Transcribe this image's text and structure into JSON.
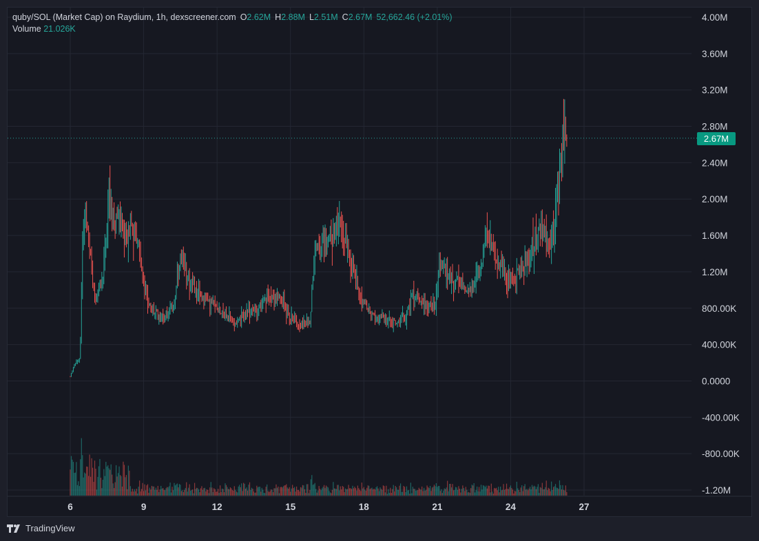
{
  "legend": {
    "symbol": "quby/SOL (Market Cap) on Raydium, 1h, dexscreener.com",
    "o_label": "O",
    "o_value": "2.62M",
    "h_label": "H",
    "h_value": "2.88M",
    "l_label": "L",
    "l_value": "2.51M",
    "c_label": "C",
    "c_value": "2.67M",
    "change": "52,662.46 (+2.01%)",
    "volume_label": "Volume",
    "volume_value": "21.026K"
  },
  "current_price_label": "2.67M",
  "brand": "TradingView",
  "colors": {
    "up": "#26a69a",
    "down": "#ef5350",
    "background": "#161821",
    "grid": "#242733",
    "axis_text": "#d1d4dc",
    "price_tag": "#089981"
  },
  "chart_data": {
    "type": "candlestick",
    "ylim": [
      -1200000,
      4000000
    ],
    "y_ticks": [
      {
        "value": 4000000,
        "label": "4.00M"
      },
      {
        "value": 3600000,
        "label": "3.60M"
      },
      {
        "value": 3200000,
        "label": "3.20M"
      },
      {
        "value": 2800000,
        "label": "2.80M"
      },
      {
        "value": 2400000,
        "label": "2.40M"
      },
      {
        "value": 2000000,
        "label": "2.00M"
      },
      {
        "value": 1600000,
        "label": "1.60M"
      },
      {
        "value": 1200000,
        "label": "1.20M"
      },
      {
        "value": 800000,
        "label": "800.00K"
      },
      {
        "value": 400000,
        "label": "400.00K"
      },
      {
        "value": 0,
        "label": "0.0000"
      },
      {
        "value": -400000,
        "label": "-400.00K"
      },
      {
        "value": -800000,
        "label": "-800.00K"
      },
      {
        "value": -1200000,
        "label": "-1.20M"
      }
    ],
    "x_range_days": [
      5.0,
      28.0
    ],
    "x_ticks": [
      {
        "day": 6,
        "label": "6"
      },
      {
        "day": 9,
        "label": "9"
      },
      {
        "day": 12,
        "label": "12"
      },
      {
        "day": 15,
        "label": "15"
      },
      {
        "day": 18,
        "label": "18"
      },
      {
        "day": 21,
        "label": "21"
      },
      {
        "day": 24,
        "label": "24"
      },
      {
        "day": 27,
        "label": "27"
      }
    ],
    "current_value": 2670000,
    "price_path": [
      [
        6.0,
        50000
      ],
      [
        6.2,
        200000
      ],
      [
        6.4,
        250000
      ],
      [
        6.5,
        1600000
      ],
      [
        6.6,
        1900000
      ],
      [
        6.8,
        1400000
      ],
      [
        7.0,
        900000
      ],
      [
        7.3,
        1100000
      ],
      [
        7.6,
        2100000
      ],
      [
        7.8,
        1600000
      ],
      [
        8.0,
        1900000
      ],
      [
        8.2,
        1500000
      ],
      [
        8.5,
        1700000
      ],
      [
        8.8,
        1500000
      ],
      [
        9.0,
        1050000
      ],
      [
        9.3,
        780000
      ],
      [
        9.8,
        700000
      ],
      [
        10.2,
        800000
      ],
      [
        10.5,
        1300000
      ],
      [
        10.8,
        1150000
      ],
      [
        11.2,
        950000
      ],
      [
        11.8,
        850000
      ],
      [
        12.2,
        760000
      ],
      [
        12.7,
        640000
      ],
      [
        13.2,
        740000
      ],
      [
        13.7,
        800000
      ],
      [
        14.2,
        950000
      ],
      [
        14.7,
        870000
      ],
      [
        15.0,
        690000
      ],
      [
        15.5,
        620000
      ],
      [
        15.8,
        650000
      ],
      [
        16.0,
        1500000
      ],
      [
        16.3,
        1450000
      ],
      [
        16.6,
        1550000
      ],
      [
        17.0,
        1700000
      ],
      [
        17.3,
        1500000
      ],
      [
        17.6,
        1200000
      ],
      [
        17.9,
        900000
      ],
      [
        18.3,
        720000
      ],
      [
        18.8,
        680000
      ],
      [
        19.3,
        640000
      ],
      [
        19.7,
        700000
      ],
      [
        20.0,
        950000
      ],
      [
        20.3,
        900000
      ],
      [
        20.6,
        820000
      ],
      [
        20.9,
        850000
      ],
      [
        21.1,
        1300000
      ],
      [
        21.4,
        1200000
      ],
      [
        21.7,
        1100000
      ],
      [
        22.0,
        1050000
      ],
      [
        22.4,
        980000
      ],
      [
        22.7,
        1200000
      ],
      [
        23.0,
        1600000
      ],
      [
        23.3,
        1450000
      ],
      [
        23.6,
        1250000
      ],
      [
        23.8,
        1150000
      ],
      [
        24.1,
        1100000
      ],
      [
        24.4,
        1250000
      ],
      [
        24.7,
        1300000
      ],
      [
        25.0,
        1600000
      ],
      [
        25.3,
        1650000
      ],
      [
        25.6,
        1500000
      ],
      [
        25.8,
        1700000
      ],
      [
        26.0,
        2250000
      ],
      [
        26.15,
        2800000
      ],
      [
        26.3,
        2670000
      ]
    ],
    "volume_note": "volume histogram bars along the bottom of the chart"
  }
}
